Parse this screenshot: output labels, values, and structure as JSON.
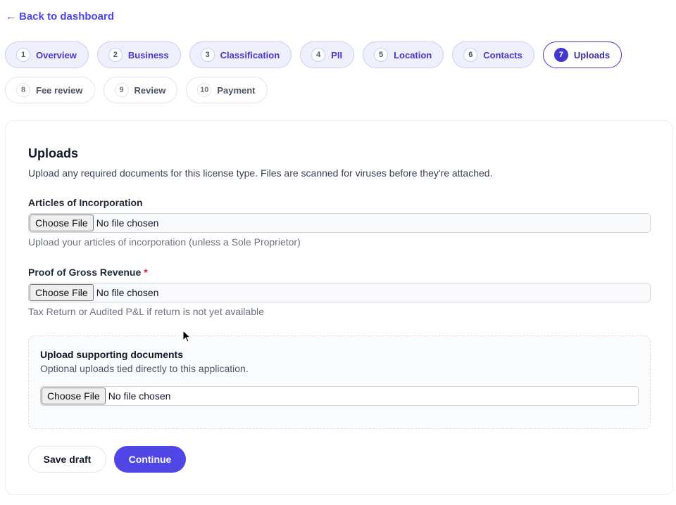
{
  "nav": {
    "back_label": "Back to dashboard",
    "back_icon": "arrow-left-icon"
  },
  "steps": [
    {
      "num": "1",
      "label": "Overview",
      "state": "done"
    },
    {
      "num": "2",
      "label": "Business",
      "state": "done"
    },
    {
      "num": "3",
      "label": "Classification",
      "state": "done"
    },
    {
      "num": "4",
      "label": "PII",
      "state": "done"
    },
    {
      "num": "5",
      "label": "Location",
      "state": "done"
    },
    {
      "num": "6",
      "label": "Contacts",
      "state": "done"
    },
    {
      "num": "7",
      "label": "Uploads",
      "state": "active"
    },
    {
      "num": "8",
      "label": "Fee review",
      "state": "todo"
    },
    {
      "num": "9",
      "label": "Review",
      "state": "todo"
    },
    {
      "num": "10",
      "label": "Payment",
      "state": "todo"
    }
  ],
  "uploads": {
    "title": "Uploads",
    "description": "Upload any required documents for this license type. Files are scanned for viruses before they're attached.",
    "fields": [
      {
        "label": "Articles of Incorporation",
        "required": false,
        "button": "Choose File",
        "status": "No file chosen",
        "help": "Upload your articles of incorporation (unless a Sole Proprietor)"
      },
      {
        "label": "Proof of Gross Revenue",
        "required": true,
        "required_mark": "*",
        "button": "Choose File",
        "status": "No file chosen",
        "help": "Tax Return or Audited P&L if return is not yet available"
      }
    ],
    "supporting": {
      "title": "Upload supporting documents",
      "description": "Optional uploads tied directly to this application.",
      "button": "Choose File",
      "status": "No file chosen"
    }
  },
  "actions": {
    "save_draft": "Save draft",
    "continue": "Continue"
  },
  "colors": {
    "accent": "#4f46e5",
    "required": "#dc2626"
  }
}
